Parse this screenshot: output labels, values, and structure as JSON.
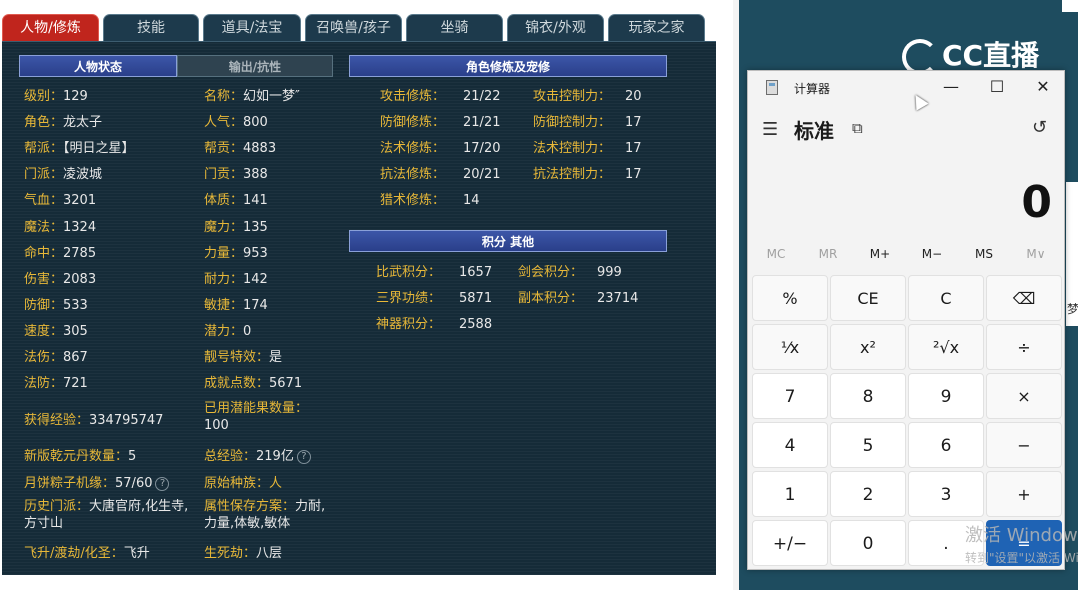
{
  "game": {
    "tabs": [
      "人物/修炼",
      "技能",
      "道具/法宝",
      "召唤兽/孩子",
      "坐骑",
      "锦衣/外观",
      "玩家之家"
    ],
    "active_tab": 0,
    "char_headers": {
      "active": "人物状态",
      "inactive": "输出/抗性"
    },
    "left_stats": [
      {
        "k": "级别：",
        "v": "129"
      },
      {
        "k": "角色：",
        "v": "龙太子"
      },
      {
        "k": "帮派：",
        "v": "【明日之星】"
      },
      {
        "k": "门派：",
        "v": "凌波城"
      },
      {
        "k": "气血：",
        "v": "3201"
      },
      {
        "k": "魔法：",
        "v": "1324"
      },
      {
        "k": "命中：",
        "v": "2785"
      },
      {
        "k": "伤害：",
        "v": "2083"
      },
      {
        "k": "防御：",
        "v": "533"
      },
      {
        "k": "速度：",
        "v": "305"
      },
      {
        "k": "法伤：",
        "v": "867"
      },
      {
        "k": "法防：",
        "v": "721"
      }
    ],
    "right_stats": [
      {
        "k": "名称：",
        "v": "幻如一梦″"
      },
      {
        "k": "人气：",
        "v": "800"
      },
      {
        "k": "帮贡：",
        "v": "4883"
      },
      {
        "k": "门贡：",
        "v": "388"
      },
      {
        "k": "体质：",
        "v": "141"
      },
      {
        "k": "魔力：",
        "v": "135"
      },
      {
        "k": "力量：",
        "v": "953"
      },
      {
        "k": "耐力：",
        "v": "142"
      },
      {
        "k": "敏捷：",
        "v": "174"
      },
      {
        "k": "潜力：",
        "v": "0"
      },
      {
        "k": "靓号特效：",
        "v": "是"
      },
      {
        "k": "成就点数：",
        "v": "5671"
      }
    ],
    "exp": {
      "k": "获得经验：",
      "v": "334795747"
    },
    "used_potential": {
      "k": "已用潜能果数量：",
      "v": "100"
    },
    "new_dan": {
      "k": "新版乾元丹数量：",
      "v": "5"
    },
    "total_exp": {
      "k": "总经验：",
      "v": "219亿"
    },
    "mooncake": {
      "k": "月饼粽子机缘：",
      "v": "57/60"
    },
    "race": {
      "k": "原始种族：",
      "v": "人"
    },
    "history": {
      "k": "历史门派：",
      "v": "大唐官府,化生寺,方寸山"
    },
    "attr_save": {
      "k": "属性保存方案：",
      "v": "力耐,力量,体敏,敏体"
    },
    "fly": {
      "k": "飞升/渡劫/化圣：",
      "v": "飞升"
    },
    "death": {
      "k": "生死劫：",
      "v": "八层"
    },
    "cultivation_header": "角色修炼及宠修",
    "cultivation": [
      {
        "k": "攻击修炼：",
        "v": "21/22",
        "k2": "攻击控制力：",
        "v2": "20"
      },
      {
        "k": "防御修炼：",
        "v": "21/21",
        "k2": "防御控制力：",
        "v2": "17"
      },
      {
        "k": "法术修炼：",
        "v": "17/20",
        "k2": "法术控制力：",
        "v2": "17"
      },
      {
        "k": "抗法修炼：",
        "v": "20/21",
        "k2": "抗法控制力：",
        "v2": "17"
      },
      {
        "k": "猎术修炼：",
        "v": "14",
        "k2": "",
        "v2": ""
      }
    ],
    "points_header": "积分 其他",
    "points": [
      {
        "k": "比武积分：",
        "v": "1657",
        "k2": "剑会积分：",
        "v2": "999"
      },
      {
        "k": "三界功绩：",
        "v": "5871",
        "k2": "副本积分：",
        "v2": "23714"
      },
      {
        "k": "神器积分：",
        "v": "2588",
        "k2": "",
        "v2": ""
      }
    ]
  },
  "brand": {
    "logo_text": "CC直播"
  },
  "side_char": "梦",
  "calculator": {
    "title": "计算器",
    "mode": "标准",
    "display": "0",
    "memory": [
      "MC",
      "MR",
      "M+",
      "M−",
      "MS",
      "M∨"
    ],
    "keys": [
      "%",
      "CE",
      "C",
      "⌫",
      "⅟x",
      "x²",
      "²√x",
      "÷",
      "7",
      "8",
      "9",
      "×",
      "4",
      "5",
      "6",
      "−",
      "1",
      "2",
      "3",
      "+",
      "+/−",
      "0",
      ".",
      "="
    ]
  },
  "watermark": {
    "line1": "激活 Windows",
    "line2": "转到\"设置\"以激活 Windows。"
  }
}
